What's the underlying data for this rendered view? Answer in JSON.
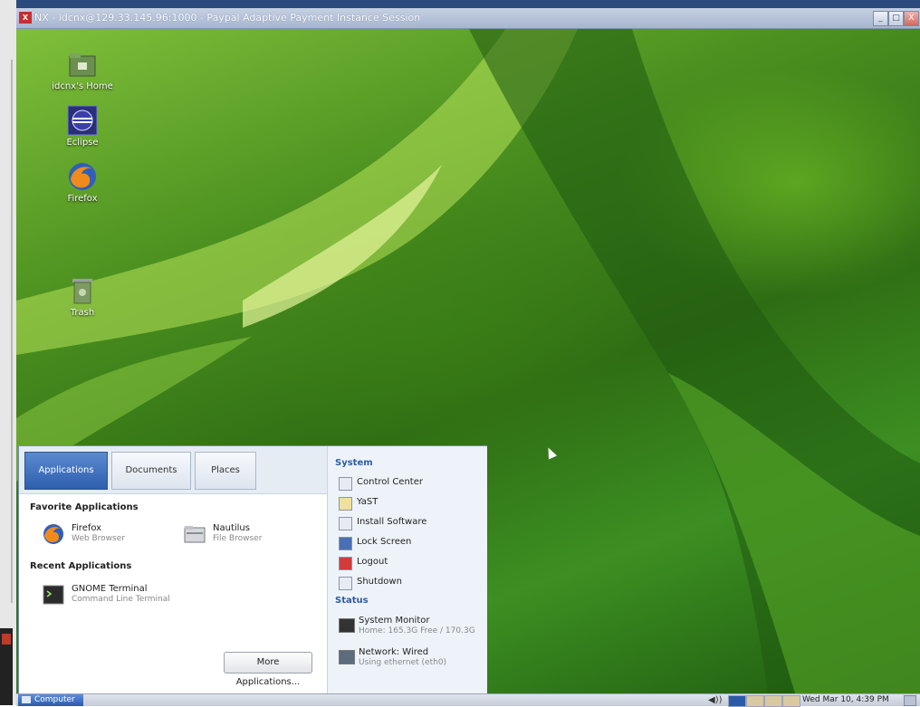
{
  "window": {
    "title": "NX - idcnx@129.33.145.96:1000 - Paypal Adaptive Payment Instance Session",
    "app_icon_glyph": "X",
    "controls": {
      "minimize": "_",
      "maximize": "□",
      "close": "X"
    }
  },
  "desktop": {
    "icons": [
      {
        "label": "idcnx's Home",
        "icon": "home-folder-icon"
      },
      {
        "label": "Eclipse",
        "icon": "eclipse-icon"
      },
      {
        "label": "Firefox",
        "icon": "firefox-icon"
      },
      {
        "label": "Trash",
        "icon": "trash-icon"
      }
    ]
  },
  "menu": {
    "tabs": [
      "Applications",
      "Documents",
      "Places"
    ],
    "active_tab": "Applications",
    "favorites_heading": "Favorite Applications",
    "favorites": [
      {
        "name": "Firefox",
        "desc": "Web Browser",
        "icon": "firefox-icon"
      },
      {
        "name": "Nautilus",
        "desc": "File Browser",
        "icon": "file-cabinet-icon"
      }
    ],
    "recent_heading": "Recent Applications",
    "recent": [
      {
        "name": "GNOME Terminal",
        "desc": "Command Line Terminal",
        "icon": "terminal-icon"
      }
    ],
    "more_button": "More Applications...",
    "system_heading": "System",
    "system_items": [
      {
        "label": "Control Center",
        "icon": "control-center-icon"
      },
      {
        "label": "YaST",
        "icon": "yast-icon"
      },
      {
        "label": "Install Software",
        "icon": "install-software-icon"
      },
      {
        "label": "Lock Screen",
        "icon": "lock-screen-icon"
      },
      {
        "label": "Logout",
        "icon": "logout-icon"
      },
      {
        "label": "Shutdown",
        "icon": "shutdown-icon"
      }
    ],
    "status_heading": "Status",
    "status_items": [
      {
        "name": "System Monitor",
        "desc": "Home: 165.3G Free / 170.3G",
        "icon": "system-monitor-icon"
      },
      {
        "name": "Network: Wired",
        "desc": "Using ethernet (eth0)",
        "icon": "network-icon"
      }
    ]
  },
  "taskbar": {
    "computer_label": "Computer",
    "volume_glyph": "◀))",
    "clock": "Wed Mar 10,  4:39 PM",
    "workspace_colors": [
      "#2d5aa8",
      "#d9c9a0",
      "#d9c9a0",
      "#d9c9a0"
    ]
  },
  "colors": {
    "accent": "#2e5fae",
    "desktop_green": "#3c8f22"
  }
}
